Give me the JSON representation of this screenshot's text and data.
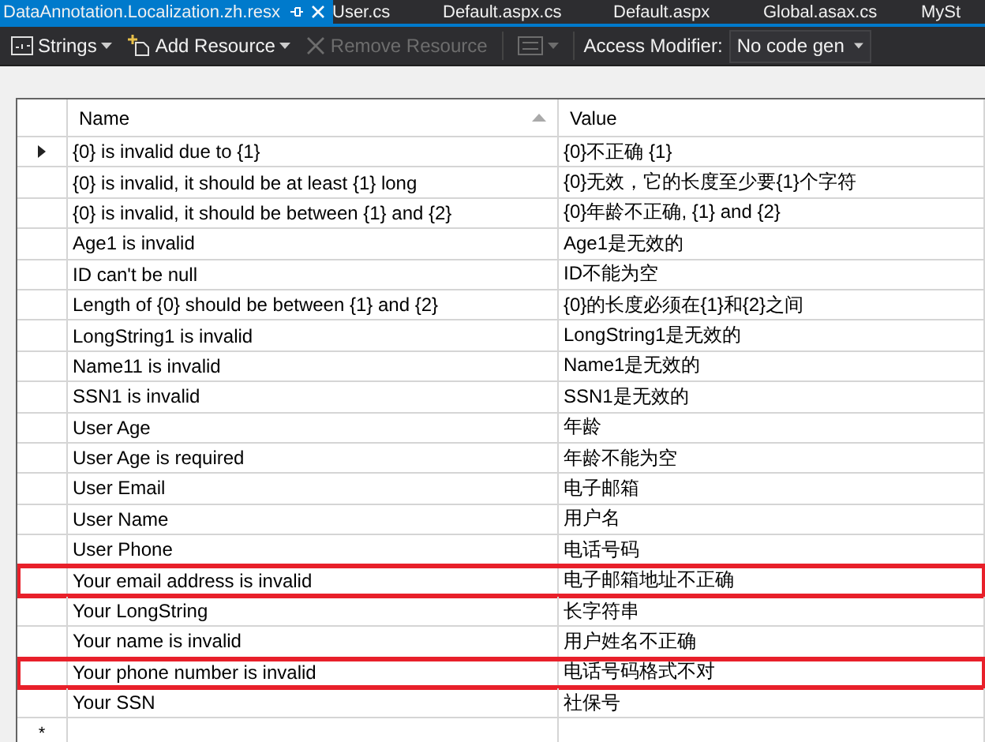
{
  "tabs": [
    {
      "label": "DataAnnotation.Localization.zh.resx",
      "selected": true,
      "pinned": true
    },
    {
      "label": "User.cs",
      "selected": false,
      "pinned": false
    },
    {
      "label": "Default.aspx.cs",
      "selected": false,
      "pinned": false
    },
    {
      "label": "Default.aspx",
      "selected": false,
      "pinned": false
    },
    {
      "label": "Global.asax.cs",
      "selected": false,
      "pinned": false
    },
    {
      "label": "MySt",
      "selected": false,
      "pinned": false
    }
  ],
  "toolbar": {
    "items": [
      {
        "kind": "dropdown",
        "label": "Strings",
        "disabled": false
      },
      {
        "kind": "dropdown",
        "label": "Add Resource",
        "disabled": false
      },
      {
        "kind": "button",
        "label": "Remove Resource",
        "disabled": true
      },
      {
        "kind": "separator"
      },
      {
        "kind": "dropdown",
        "disabled": true
      },
      {
        "kind": "separator"
      },
      {
        "kind": "label",
        "label": "Access Modifier:"
      },
      {
        "kind": "select",
        "value": "No code gen"
      }
    ]
  },
  "table": {
    "columns": [
      {
        "label": "Name",
        "sorted": true
      },
      {
        "label": "Value",
        "sorted": false
      }
    ],
    "rows": [
      {
        "name": "{0} is invalid due to {1}",
        "value": "{0}不正确 {1}",
        "current": true,
        "highlighted": false
      },
      {
        "name": "{0} is invalid, it should be at least {1} long",
        "value": "{0}无效，它的长度至少要{1}个字符",
        "current": false,
        "highlighted": false
      },
      {
        "name": "{0} is invalid, it should be between {1} and {2}",
        "value": "{0}年龄不正确, {1} and {2}",
        "current": false,
        "highlighted": false
      },
      {
        "name": "Age1 is invalid",
        "value": "Age1是无效的",
        "current": false,
        "highlighted": false
      },
      {
        "name": "ID can't be null",
        "value": "ID不能为空",
        "current": false,
        "highlighted": false
      },
      {
        "name": "Length of {0} should be between {1} and {2}",
        "value": "{0}的长度必须在{1}和{2}之间",
        "current": false,
        "highlighted": false
      },
      {
        "name": "LongString1 is invalid",
        "value": "LongString1是无效的",
        "current": false,
        "highlighted": false
      },
      {
        "name": "Name11 is invalid",
        "value": "Name1是无效的",
        "current": false,
        "highlighted": false
      },
      {
        "name": "SSN1 is invalid",
        "value": "SSN1是无效的",
        "current": false,
        "highlighted": false
      },
      {
        "name": "User Age",
        "value": "年龄",
        "current": false,
        "highlighted": false
      },
      {
        "name": "User Age is required",
        "value": "年龄不能为空",
        "current": false,
        "highlighted": false
      },
      {
        "name": "User Email",
        "value": "电子邮箱",
        "current": false,
        "highlighted": false
      },
      {
        "name": "User Name",
        "value": "用户名",
        "current": false,
        "highlighted": false
      },
      {
        "name": "User Phone",
        "value": "电话号码",
        "current": false,
        "highlighted": false
      },
      {
        "name": "Your email address is invalid",
        "value": "电子邮箱地址不正确",
        "current": false,
        "highlighted": true
      },
      {
        "name": "Your LongString",
        "value": "长字符串",
        "current": false,
        "highlighted": false
      },
      {
        "name": "Your name is invalid",
        "value": "用户姓名不正确",
        "current": false,
        "highlighted": false
      },
      {
        "name": "Your phone number is invalid",
        "value": "电话号码格式不对",
        "current": false,
        "highlighted": true
      },
      {
        "name": "Your SSN",
        "value": "社保号",
        "current": false,
        "highlighted": false
      }
    ],
    "new_row": {
      "marker": "*"
    }
  }
}
